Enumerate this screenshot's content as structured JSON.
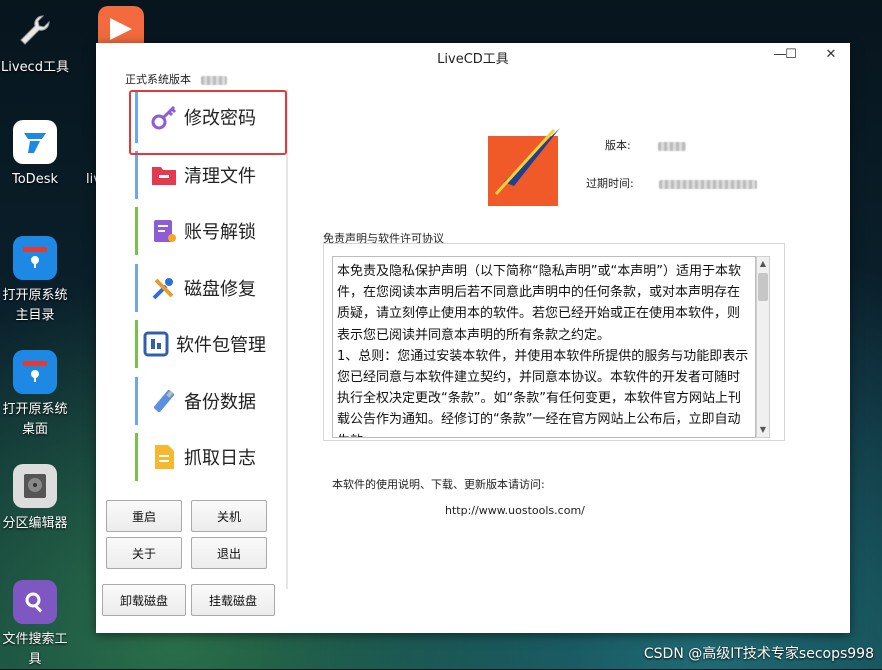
{
  "desktop": {
    "icons": [
      {
        "label_lines": [
          "Livecd工具"
        ],
        "icon": "wrench-icon"
      },
      {
        "label_lines": [
          "ToDesk"
        ],
        "icon": "todesk-icon"
      },
      {
        "label_lines": [
          "打开原系统",
          "主目录"
        ],
        "icon": "home-folder-icon"
      },
      {
        "label_lines": [
          "打开原系统",
          "桌面"
        ],
        "icon": "desktop-folder-icon"
      },
      {
        "label_lines": [
          "分区编辑器"
        ],
        "icon": "disk-partition-icon"
      },
      {
        "label_lines": [
          "文件搜索工",
          "具"
        ],
        "icon": "file-search-icon"
      }
    ],
    "partial_label": "liv"
  },
  "window": {
    "title": "LiveCD工具",
    "controls": {
      "minimize": "—",
      "maximize": "☐",
      "close": "✕"
    },
    "version_label": "正式系统版本",
    "menu": [
      {
        "label": "修改密码",
        "icon": "key-icon",
        "selected": true
      },
      {
        "label": "清理文件",
        "icon": "folder-clean-icon"
      },
      {
        "label": "账号解锁",
        "icon": "account-unlock-icon"
      },
      {
        "label": "磁盘修复",
        "icon": "disk-repair-icon"
      },
      {
        "label": "软件包管理",
        "icon": "package-manager-icon"
      },
      {
        "label": "备份数据",
        "icon": "usb-backup-icon"
      },
      {
        "label": "抓取日志",
        "icon": "log-file-icon"
      }
    ],
    "buttons": {
      "restart": "重启",
      "shutdown": "关机",
      "about": "关于",
      "exit": "退出",
      "unmount": "卸载磁盘",
      "mount": "挂载磁盘"
    },
    "info": {
      "version_label": "版本:",
      "expire_label": "过期时间:"
    },
    "license": {
      "title": "免责声明与软件许可协议",
      "text": "本免责及隐私保护声明（以下简称“隐私声明”或“本声明”）适用于本软件，在您阅读本声明后若不同意此声明中的任何条款，或对本声明存在质疑，请立刻停止使用本的软件。若您已经开始或正在使用本软件，则表示您已阅读并同意本声明的所有条款之约定。\n1、总则：您通过安装本软件，并使用本软件所提供的服务与功能即表示您已经同意与本软件建立契约，并同意本协议。本软件的开发者可随时执行全权决定更改“条款”。如“条款”有任何变更，本软件官方网站上刊载公告作为通知。经修订的“条款”一经在官方网站上公布后，立即自动生效。"
    },
    "footer": {
      "help_text": "本软件的使用说明、下载、更新版本请访问:",
      "url": "http://www.uostools.com/"
    }
  },
  "watermark": "CSDN @高级IT技术专家secops998"
}
